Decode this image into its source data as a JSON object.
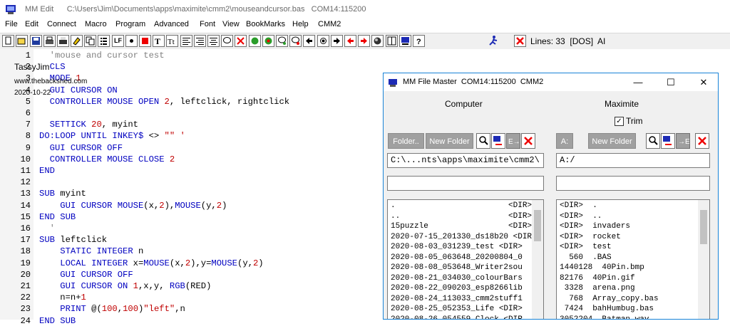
{
  "window": {
    "app_name": "MM Edit",
    "file_path": "C:\\Users\\Jim\\Documents\\apps\\maximite\\cmm2\\mouseandcursor.bas",
    "port": "COM14:115200"
  },
  "menu": [
    "File",
    "Edit",
    "Connect",
    "Macro",
    "Program",
    "Advanced",
    "Font",
    "View",
    "BookMarks",
    "Help",
    "CMM2"
  ],
  "toolbar": {
    "lf_label": "LF",
    "status_text": "Lines: 33  [DOS]  AI",
    "icons": [
      "new-icon",
      "open-icon",
      "save-icon",
      "print-preview-icon",
      "print-icon",
      "erase-icon",
      "copy-icon",
      "list-icon",
      "lf-icon",
      "dot-icon",
      "stop-icon",
      "font-icon",
      "text-size-icon",
      "align-left-icon",
      "align-right-icon",
      "align-center-icon",
      "comment-icon",
      "cancel-icon",
      "bug-icon",
      "bug-run-icon",
      "chat-icon",
      "chat-alt-icon",
      "arrow-left-icon",
      "record-icon",
      "arrow-right-icon",
      "arrow-left-red-icon",
      "arrow-right-red-icon",
      "globe-icon",
      "columns-icon",
      "monitor-icon",
      "help-icon",
      "run-icon",
      "close-icon"
    ]
  },
  "watermark": {
    "author": "TassyJim",
    "site": "www.thebackshed.com",
    "date": "2020-10-22"
  },
  "code_lines": [
    {
      "n": "1",
      "seg": [
        [
          "cmt",
          "  'mouse and cursor test"
        ]
      ]
    },
    {
      "n": "2",
      "seg": [
        [
          "kw",
          "  CLS"
        ]
      ]
    },
    {
      "n": "3",
      "seg": [
        [
          "kw",
          "  MODE "
        ],
        [
          "num",
          "1"
        ]
      ]
    },
    {
      "n": "4",
      "seg": [
        [
          "kw",
          "  GUI CURSOR ON"
        ]
      ]
    },
    {
      "n": "5",
      "seg": [
        [
          "kw",
          "  CONTROLLER MOUSE OPEN "
        ],
        [
          "num",
          "2"
        ],
        [
          "txt",
          ", leftclick, rightclick"
        ]
      ]
    },
    {
      "n": "6",
      "seg": []
    },
    {
      "n": "7",
      "seg": [
        [
          "kw",
          "  SETTICK "
        ],
        [
          "num",
          "20"
        ],
        [
          "txt",
          ", myint"
        ]
      ]
    },
    {
      "n": "8",
      "seg": [
        [
          "kw",
          "DO:LOOP UNTIL INKEY$ "
        ],
        [
          "txt",
          "<> "
        ],
        [
          "str",
          "\"\" '"
        ]
      ]
    },
    {
      "n": "9",
      "seg": [
        [
          "kw",
          "  GUI CURSOR OFF"
        ]
      ]
    },
    {
      "n": "10",
      "seg": [
        [
          "kw",
          "  CONTROLLER MOUSE CLOSE "
        ],
        [
          "num",
          "2"
        ]
      ]
    },
    {
      "n": "11",
      "seg": [
        [
          "kw",
          "END"
        ]
      ]
    },
    {
      "n": "12",
      "seg": []
    },
    {
      "n": "13",
      "seg": [
        [
          "kw",
          "SUB "
        ],
        [
          "txt",
          "myint"
        ]
      ]
    },
    {
      "n": "14",
      "seg": [
        [
          "kw",
          "    GUI CURSOR MOUSE"
        ],
        [
          "txt",
          "(x,"
        ],
        [
          "num",
          "2"
        ],
        [
          "txt",
          "),"
        ],
        [
          "kw",
          "MOUSE"
        ],
        [
          "txt",
          "(y,"
        ],
        [
          "num",
          "2"
        ],
        [
          "txt",
          ")"
        ]
      ]
    },
    {
      "n": "15",
      "seg": [
        [
          "kw",
          "END SUB"
        ]
      ]
    },
    {
      "n": "16",
      "seg": [
        [
          "cmt",
          "  '"
        ]
      ]
    },
    {
      "n": "17",
      "seg": [
        [
          "kw",
          "SUB "
        ],
        [
          "txt",
          "leftclick"
        ]
      ]
    },
    {
      "n": "18",
      "seg": [
        [
          "kw",
          "    STATIC INTEGER "
        ],
        [
          "txt",
          "n"
        ]
      ]
    },
    {
      "n": "19",
      "seg": [
        [
          "kw",
          "    LOCAL INTEGER "
        ],
        [
          "txt",
          "x="
        ],
        [
          "kw",
          "MOUSE"
        ],
        [
          "txt",
          "(x,"
        ],
        [
          "num",
          "2"
        ],
        [
          "txt",
          "),y="
        ],
        [
          "kw",
          "MOUSE"
        ],
        [
          "txt",
          "(y,"
        ],
        [
          "num",
          "2"
        ],
        [
          "txt",
          ")"
        ]
      ]
    },
    {
      "n": "20",
      "seg": [
        [
          "kw",
          "    GUI CURSOR OFF"
        ]
      ]
    },
    {
      "n": "21",
      "seg": [
        [
          "kw",
          "    GUI CURSOR ON "
        ],
        [
          "num",
          "1"
        ],
        [
          "txt",
          ",x,y, "
        ],
        [
          "kw",
          "RGB"
        ],
        [
          "txt",
          "(RED)"
        ]
      ]
    },
    {
      "n": "22",
      "seg": [
        [
          "txt",
          "    n=n+"
        ],
        [
          "num",
          "1"
        ]
      ]
    },
    {
      "n": "23",
      "seg": [
        [
          "kw",
          "    PRINT "
        ],
        [
          "txt",
          "@("
        ],
        [
          "num",
          "100"
        ],
        [
          "txt",
          ","
        ],
        [
          "num",
          "100"
        ],
        [
          "txt",
          ")"
        ],
        [
          "str",
          "\"left\""
        ],
        [
          "txt",
          ",n"
        ]
      ]
    },
    {
      "n": "24",
      "seg": [
        [
          "kw",
          "END SUB"
        ]
      ]
    }
  ],
  "file_master": {
    "title": "MM File Master  COM14:115200  CMM2",
    "win_min": "—",
    "win_max": "☐",
    "win_close": "✕",
    "computer_label": "Computer",
    "maximite_label": "Maximite",
    "trim_label": "Trim",
    "trim_check": "✓",
    "folder_btn": "Folder..",
    "new_folder_left": "New Folder",
    "drive_btn": "A:",
    "new_folder_right": "New Folder",
    "left_path": "C:\\...nts\\apps\\maximite\\cmm2\\",
    "right_path": "A:/",
    "left_filter": "",
    "right_filter": "",
    "left_files": [
      ".                        <DIR>",
      "..                       <DIR>",
      "15puzzle                 <DIR>",
      "2020-07-15_201330_ds18b20 <DIR",
      "2020-08-03_031239_test <DIR>",
      "2020-08-05_063648_20200804_0",
      "2020-08-08_053648_Writer2sou",
      "2020-08-21_034030_colourBars",
      "2020-08-22_090203_esp8266lib",
      "2020-08-24_113033_cmm2stuff1",
      "2020-08-25_052353_Life <DIR>",
      "2020-08-26_054559_Clock <DIR"
    ],
    "right_files": [
      "<DIR>  .",
      "<DIR>  ..",
      "<DIR>  invaders",
      "<DIR>  rocket",
      "<DIR>  test",
      "  560  .BAS",
      "1440128  40Pin.bmp",
      "82176  40Pin.gif",
      " 3328  arena.png",
      "  768  Array_copy.bas",
      " 7424  bahHumbug.bas",
      "3052204  Batman.wav"
    ]
  }
}
